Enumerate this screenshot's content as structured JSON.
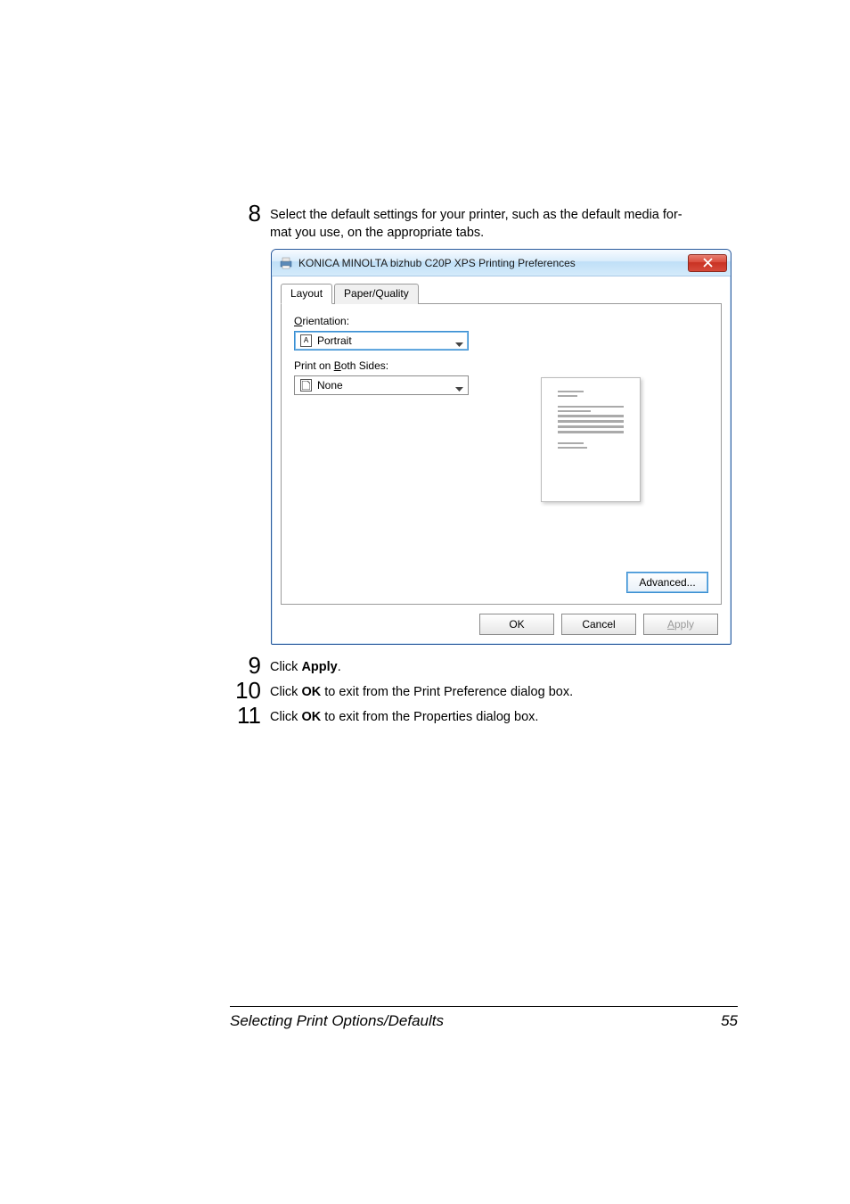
{
  "steps": {
    "s8": {
      "num": "8",
      "text_a": "Select the default settings for your printer, such as the default media for-",
      "text_b": "mat you use, on the appropriate tabs."
    },
    "s9": {
      "num": "9",
      "text_a": "Click ",
      "bold": "Apply",
      "text_b": "."
    },
    "s10": {
      "num": "10",
      "text_a": "Click ",
      "bold": "OK",
      "text_b": " to exit from the Print Preference dialog box."
    },
    "s11": {
      "num": "11",
      "text_a": "Click ",
      "bold": "OK",
      "text_b": " to exit from the Properties dialog box."
    }
  },
  "dialog": {
    "title": "KONICA MINOLTA bizhub C20P XPS Printing Preferences",
    "close_x": "X",
    "tabs": {
      "layout": "Layout",
      "paper": "Paper/Quality"
    },
    "orientation_label_pre": "O",
    "orientation_label": "rientation:",
    "orientation_value": "Portrait",
    "orientation_icon": "A",
    "both_sides_label_a": "Print on ",
    "both_sides_label_u": "B",
    "both_sides_label_b": "oth Sides:",
    "both_sides_value": "None",
    "advanced": "Advanced...",
    "ok": "OK",
    "cancel": "Cancel",
    "apply_pre": "A",
    "apply": "pply"
  },
  "footer": {
    "title": "Selecting Print Options/Defaults",
    "page": "55"
  }
}
